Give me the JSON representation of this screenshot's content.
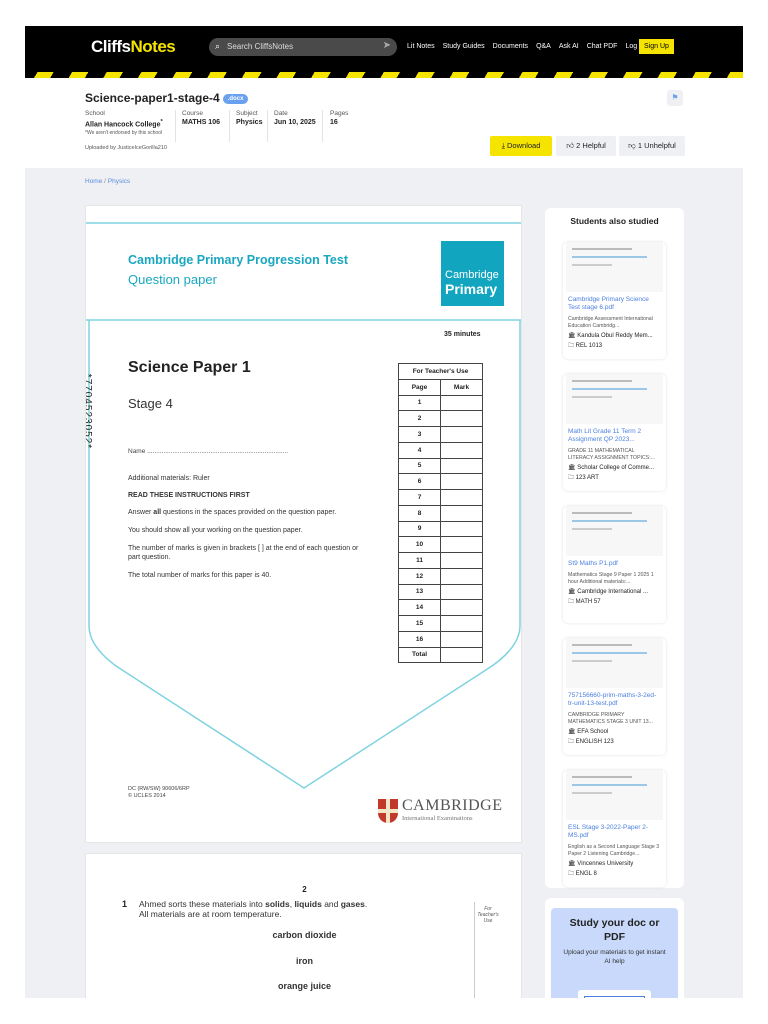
{
  "header": {
    "logo_a": "Cliffs",
    "logo_b": "Notes",
    "search_placeholder": "Search CliffsNotes",
    "nav": [
      "Lit Notes",
      "Study Guides",
      "Documents",
      "Q&A",
      "Ask AI",
      "Chat PDF",
      "Log In"
    ],
    "signup": "Sign Up"
  },
  "doc": {
    "title": "Science-paper1-stage-4",
    "badge": ".docx",
    "school_label": "School",
    "school": "Allan Hancock College",
    "school_mark": "*",
    "school_note": "*We aren't endorsed by this school",
    "course_label": "Course",
    "course": "MATHS 106",
    "subject_label": "Subject",
    "subject": "Physics",
    "date_label": "Date",
    "date": "Jun 10, 2025",
    "pages_label": "Pages",
    "pages": "16",
    "uploaded": "Uploaded by JusticeIceGorilla210",
    "download": "Download",
    "helpful": "2 Helpful",
    "unhelpful": "1 Unhelpful"
  },
  "breadcrumb": {
    "home": "Home",
    "sep": "/",
    "current": "Physics"
  },
  "page1": {
    "series": "Cambridge Primary Progression Test",
    "kind": "Question paper",
    "logo_top": "Cambridge",
    "logo_bottom": "Primary",
    "duration": "35 minutes",
    "barcode": "*7704523052*",
    "title": "Science Paper 1",
    "stage": "Stage 4",
    "name_line": "Name ..............................................................................",
    "materials": "Additional materials:  Ruler",
    "instr_head": "READ THESE INSTRUCTIONS FIRST",
    "instr1_a": "Answer ",
    "instr1_b": "all",
    "instr1_c": " questions in the spaces provided on the question paper.",
    "instr2": "You should show all your working on the question paper.",
    "instr3": "The number of marks is given in brackets [ ] at the end of each question or part question.",
    "instr4": "The total number of marks for this paper is 40.",
    "table_head": "For Teacher's Use",
    "col_page": "Page",
    "col_mark": "Mark",
    "rows": [
      "1",
      "2",
      "3",
      "4",
      "5",
      "6",
      "7",
      "8",
      "9",
      "10",
      "11",
      "12",
      "13",
      "14",
      "15",
      "16"
    ],
    "total": "Total",
    "code": "DC (RW/SW) 90606/6RP",
    "copyright": "© UCLES 2014",
    "cam_name": "CAMBRIDGE",
    "cam_sub": "International Examinations"
  },
  "page2": {
    "number": "2",
    "q": "1",
    "q_a": "Ahmed sorts these materials into ",
    "solids": "solids",
    ",": ", ",
    "liquids": "liquids",
    "and": " and ",
    "gases": "gases",
    "dot": ".",
    "q_line2": "All materials are at room temperature.",
    "side_note": "For Teacher's Use",
    "materials": [
      "carbon dioxide",
      "iron",
      "orange juice"
    ]
  },
  "sidebar": {
    "title": "Students also studied",
    "cards": [
      {
        "title": "Cambridge Primary Science Test stage 6.pdf",
        "desc": "Cambridge Assessment International Education Cambridg...",
        "school": "Kandula Obul Reddy Mem...",
        "course": "REL 1013"
      },
      {
        "title": "Math Lit Grade 11 Term 2 Assignment QP 2023...",
        "desc": "GRADE 11 MATHEMATICAL LITERACY ASSIGNMENT TOPICS:...",
        "school": "Scholar College of Comme...",
        "course": "123 ART"
      },
      {
        "title": "St9 Maths P1.pdf",
        "desc": "Mathematics Stage 9 Paper 1 2025 1 hour Additional materials:...",
        "school": "Cambridge International ...",
        "course": "MATH 57"
      },
      {
        "title": "757156660-prim-maths-3-2ed-tr-unit-13-test.pdf",
        "desc": "CAMBRIDGE PRIMARY MATHEMATICS STAGE 3 UNIT 13...",
        "school": "EFA School",
        "course": "ENGLISH 123"
      },
      {
        "title": "ESL Stage 3-2022-Paper 2-MS.pdf",
        "desc": "English as a Second Language Stage 3 Paper 2 Listening Cambridge...",
        "school": "Vincennes University",
        "course": "ENGL 8"
      }
    ]
  },
  "study": {
    "title": "Study your doc or PDF",
    "sub": "Upload your materials to get instant AI help"
  },
  "colors": {
    "brand_yellow": "#f5e400",
    "teal": "#1aa7c0",
    "link": "#4a7fe0"
  }
}
